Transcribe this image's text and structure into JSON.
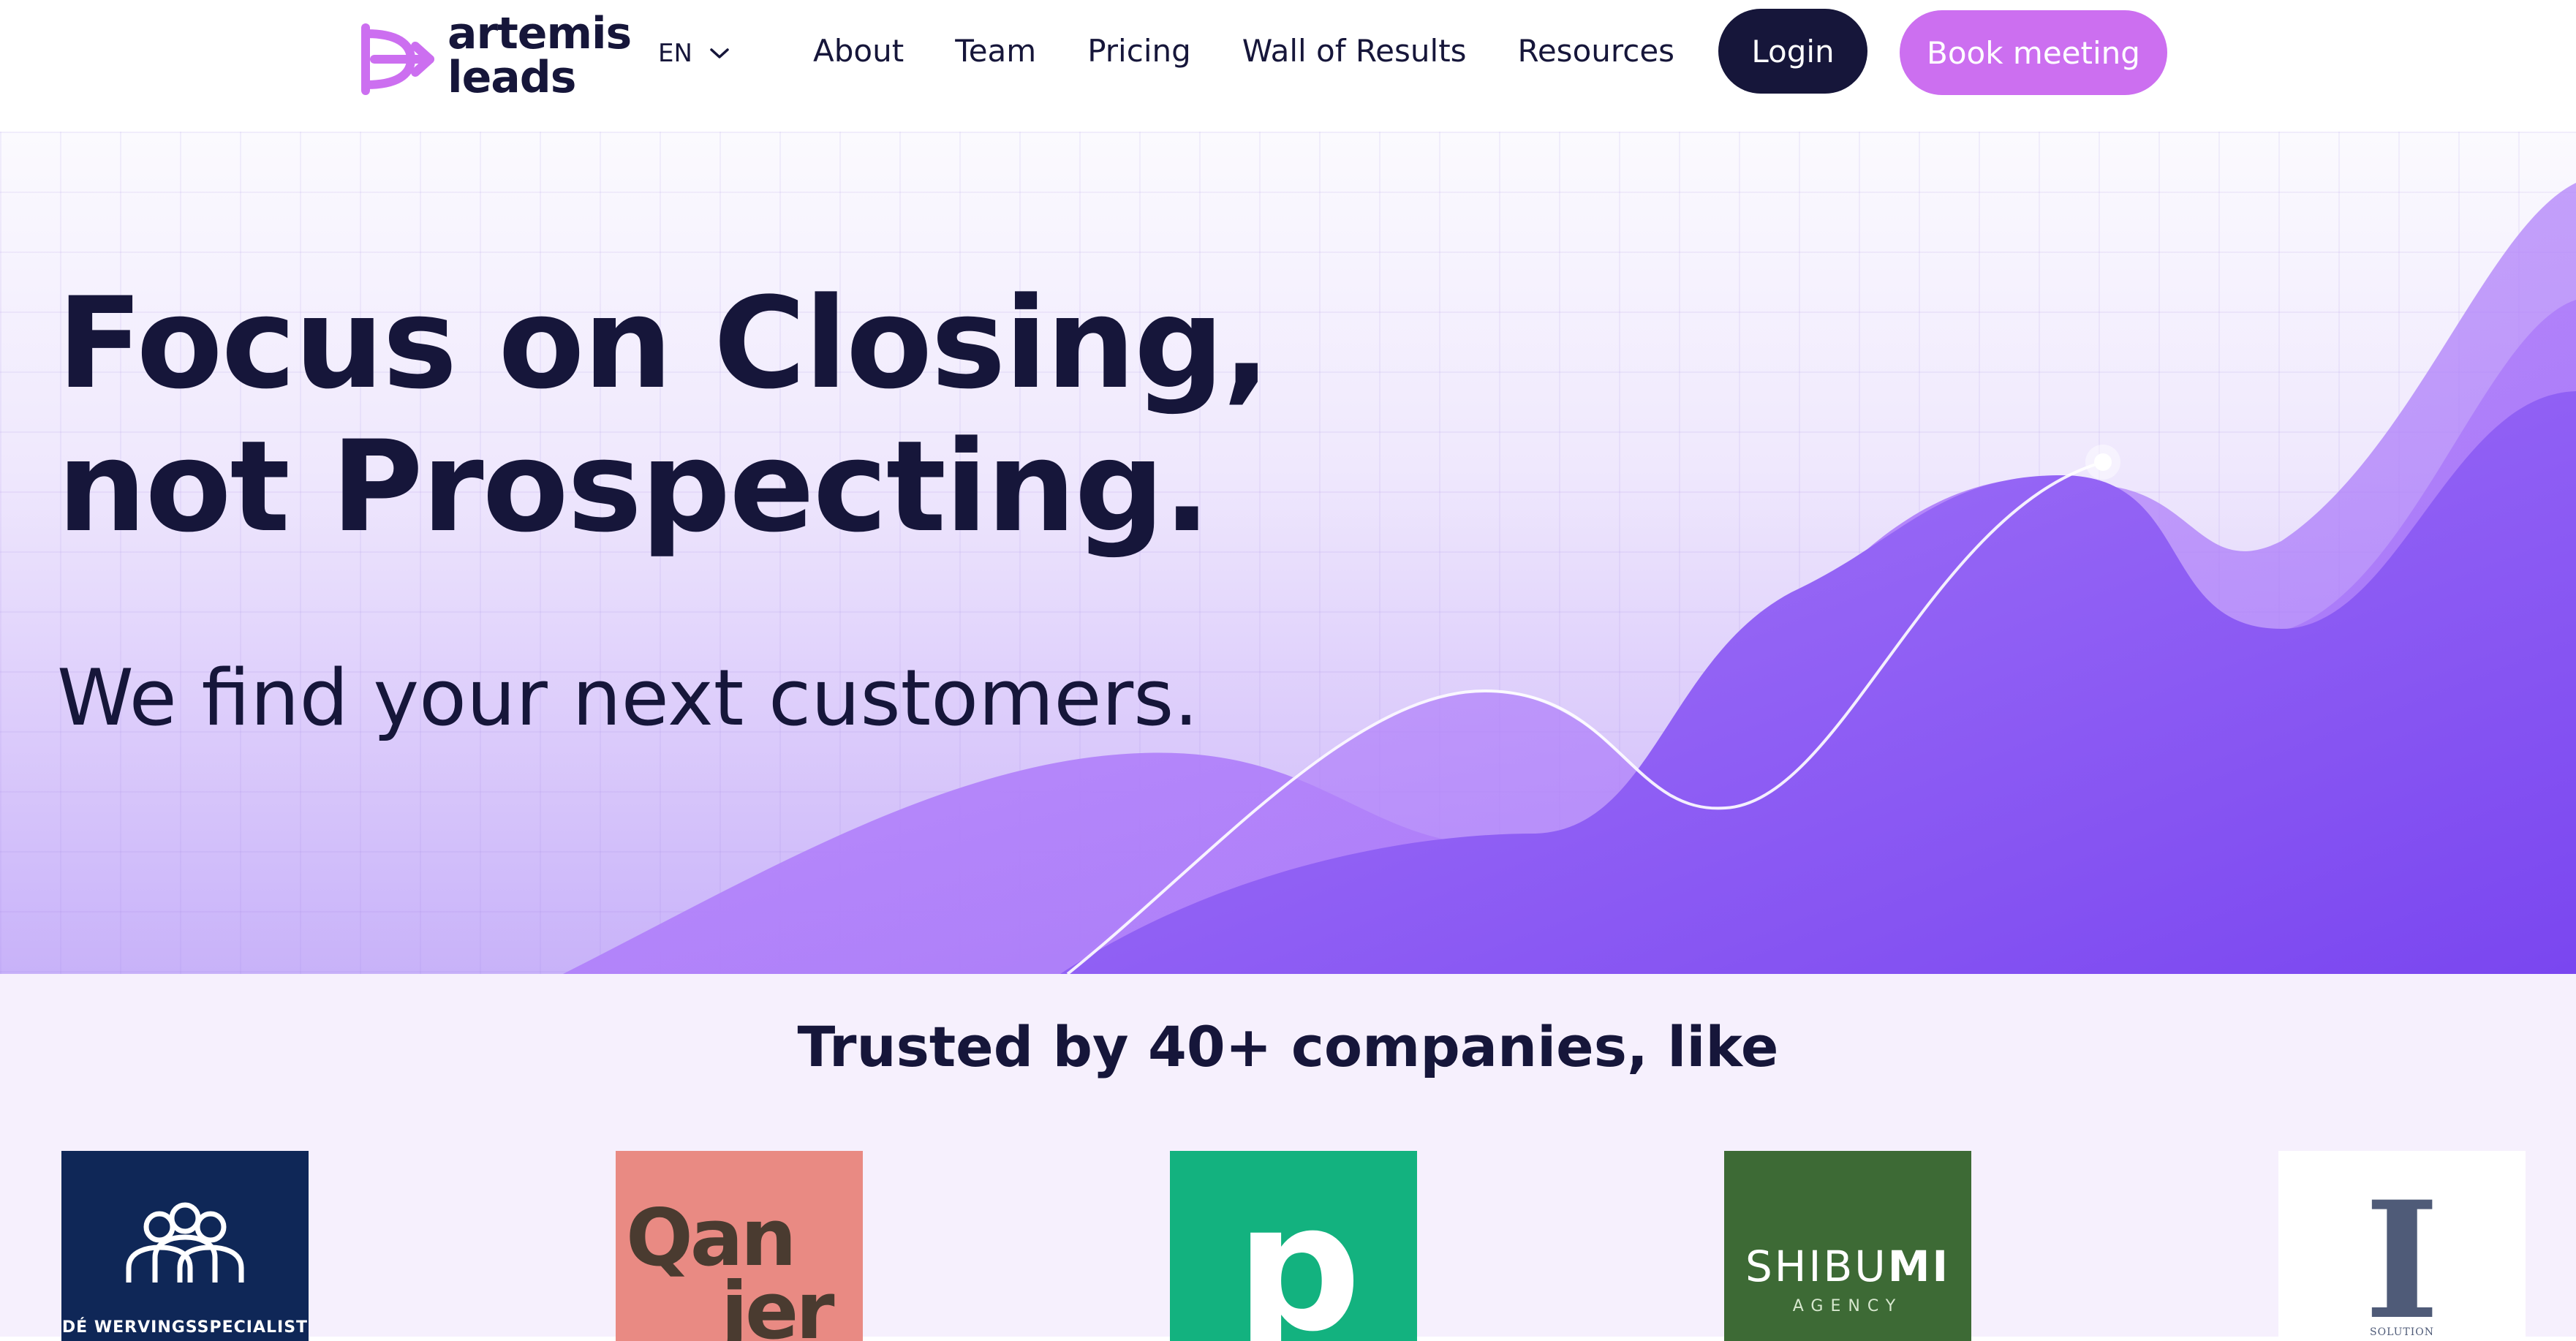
{
  "header": {
    "logo_line1": "artemis",
    "logo_line2": "leads",
    "language": "EN",
    "nav": [
      "About",
      "Team",
      "Pricing",
      "Wall of Results",
      "Resources"
    ],
    "login_label": "Login",
    "book_label": "Book meeting"
  },
  "hero": {
    "title_line1": "Focus on Closing,",
    "title_line2": "not Prospecting.",
    "subtitle": "We find your next customers."
  },
  "trusted": {
    "title": "Trusted by 40+ companies, like",
    "logos": [
      {
        "name": "de-wervingsspecialist",
        "caption": "DÉ WERVINGSSPECIALIST"
      },
      {
        "name": "qanjer",
        "line1": "Qan",
        "line2": "jer"
      },
      {
        "name": "p-logo",
        "letter": "p"
      },
      {
        "name": "shibumi",
        "word_light": "SHIBU",
        "word_bold": "MI",
        "sub": "AGENCY"
      },
      {
        "name": "i-logo",
        "letter": "I",
        "caption": "SOLUTION"
      }
    ]
  },
  "colors": {
    "navy": "#16163a",
    "accent_pink": "#cc6ff0",
    "purple": "#8a55f2",
    "hero_bg_top": "#fbfafe",
    "hero_bg_bottom": "#c8b2f9"
  },
  "icons": [
    "arrow-logo-icon",
    "chevron-down-icon"
  ]
}
